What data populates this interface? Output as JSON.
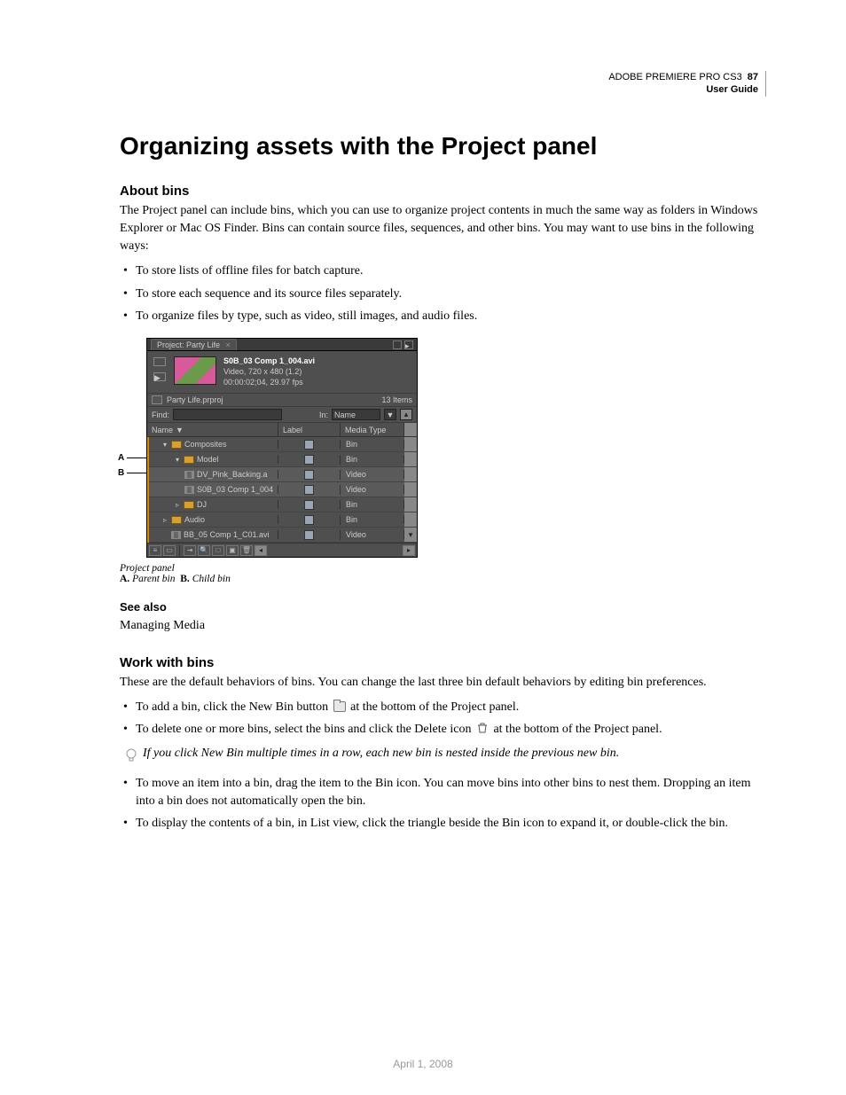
{
  "header": {
    "product": "ADOBE PREMIERE PRO CS3",
    "guide": "User Guide",
    "page": "87"
  },
  "h1": "Organizing assets with the Project panel",
  "about": {
    "heading": "About bins",
    "para": "The Project panel can include bins, which you can use to organize project contents in much the same way as folders in Windows Explorer or Mac OS Finder. Bins can contain source files, sequences, and other bins. You may want to use bins in the following ways:",
    "bul1": "To store lists of offline files for batch capture.",
    "bul2": "To store each sequence and its source files separately.",
    "bul3": "To organize files by type, such as video, still images, and audio files."
  },
  "panel": {
    "tab_title": "Project: Party Life",
    "clip_name": "S0B_03 Comp 1_004.avi",
    "clip_meta1": "Video, 720 x 480 (1.2)",
    "clip_meta2": "00:00:02;04, 29.97 fps",
    "project_file": "Party Life.prproj",
    "item_count": "13 Items",
    "find_label": "Find:",
    "in_label": "In:",
    "in_value": "Name",
    "col_name": "Name",
    "col_label": "Label",
    "col_type": "Media Type",
    "rows": {
      "r0": {
        "name": "Composites",
        "type": "Bin"
      },
      "r1": {
        "name": "Model",
        "type": "Bin"
      },
      "r2": {
        "name": "DV_Pink_Backing.a",
        "type": "Video"
      },
      "r3": {
        "name": "S0B_03 Comp 1_004",
        "type": "Video"
      },
      "r4": {
        "name": "DJ",
        "type": "Bin"
      },
      "r5": {
        "name": "Audio",
        "type": "Bin"
      },
      "r6": {
        "name": "BB_05 Comp 1_C01.avi",
        "type": "Video"
      }
    }
  },
  "figcap": {
    "title": "Project panel",
    "a_lbl": "A.",
    "a_txt": "Parent bin",
    "b_lbl": "B.",
    "b_txt": "Child bin"
  },
  "callout_a": "A",
  "callout_b": "B",
  "seealso": {
    "heading": "See also",
    "link": "Managing Media"
  },
  "work": {
    "heading": "Work with bins",
    "para": "These are the default behaviors of bins. You can change the last three bin default behaviors by editing bin preferences.",
    "b1a": "To add a bin, click the New Bin button ",
    "b1b": " at the bottom of the Project panel.",
    "b2a": "To delete one or more bins, select the bins and click the Delete icon ",
    "b2b": " at the bottom of the Project panel.",
    "tip": "If you click New Bin multiple times in a row, each new bin is nested inside the previous new bin.",
    "b3": "To move an item into a bin, drag the item to the Bin icon. You can move bins into other bins to nest them. Dropping an item into a bin does not automatically open the bin.",
    "b4": "To display the contents of a bin, in List view, click the triangle beside the Bin icon to expand it, or double-click the bin."
  },
  "footer_date": "April 1, 2008"
}
